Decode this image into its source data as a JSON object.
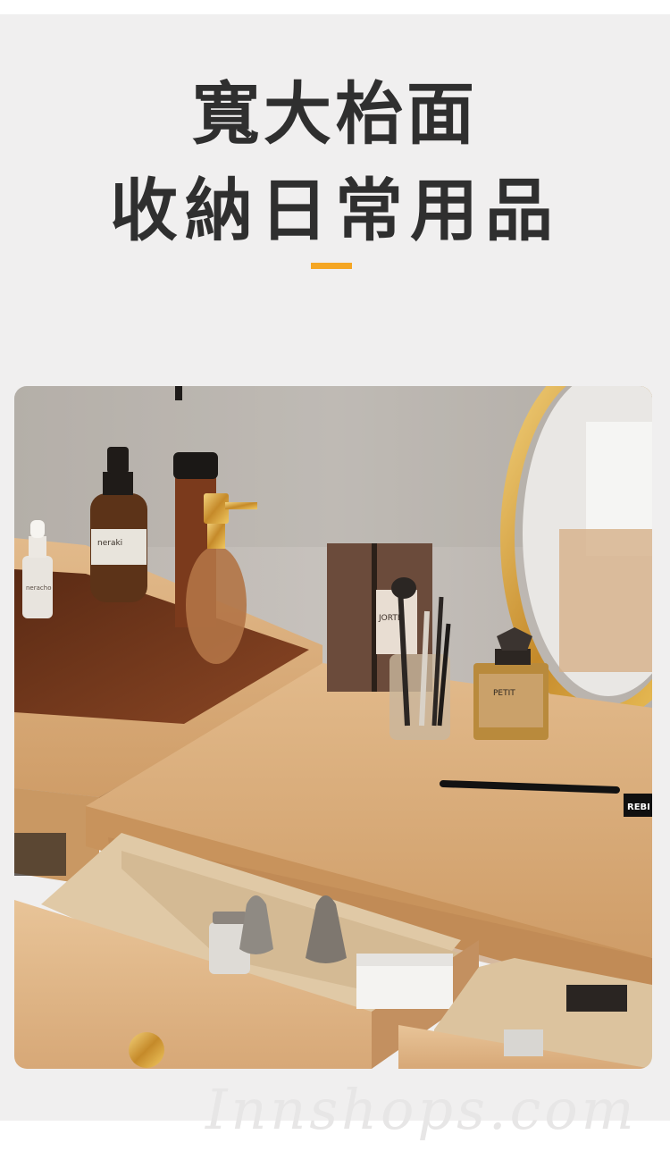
{
  "heading": {
    "line1": "寬大枱面",
    "line2": "收納日常用品"
  },
  "accent_color": "#f5a623",
  "photo": {
    "subject": "vanity-table",
    "labels": {
      "bottle": "neraki",
      "dropper": "neracho",
      "box": "JORTE",
      "perfume": "PETIT",
      "pencil": "REBI"
    }
  },
  "watermark": "Innshops.com"
}
